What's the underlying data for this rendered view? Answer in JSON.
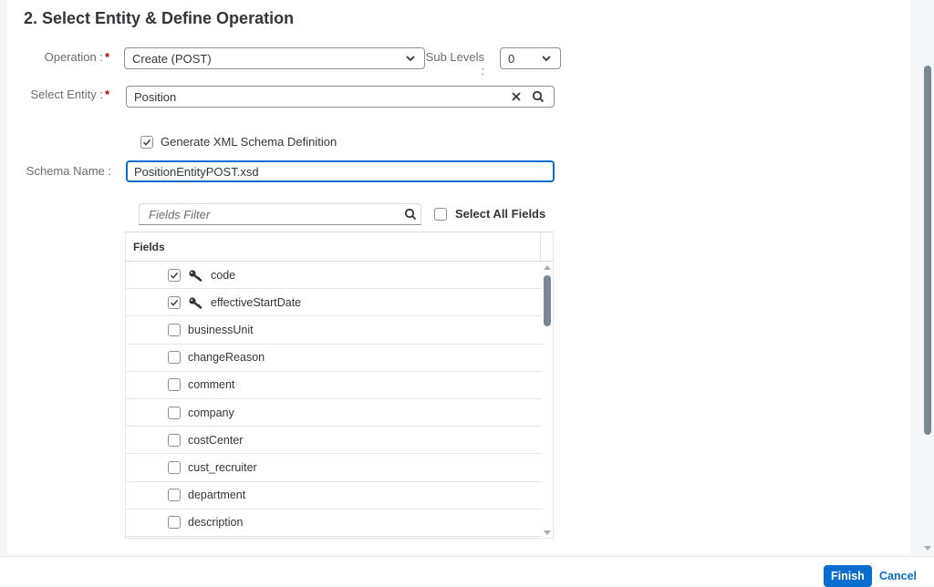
{
  "section_title": "2. Select Entity & Define Operation",
  "operation": {
    "label": "Operation :",
    "required_mark": "*",
    "value": "Create (POST)"
  },
  "sub_levels": {
    "label": "Sub Levels :",
    "value": "0"
  },
  "entity": {
    "label": "Select Entity :",
    "required_mark": "*",
    "value": "Position"
  },
  "generate_xsd": {
    "label": "Generate XML Schema Definition",
    "checked": true
  },
  "schema_name": {
    "label": "Schema Name :",
    "value": "PositionEntityPOST.xsd"
  },
  "fields_filter": {
    "placeholder": "Fields Filter"
  },
  "select_all": {
    "label": "Select All Fields",
    "checked": false
  },
  "fields_table": {
    "header": "Fields",
    "rows": [
      {
        "name": "code",
        "checked": true,
        "key": true
      },
      {
        "name": "effectiveStartDate",
        "checked": true,
        "key": true
      },
      {
        "name": "businessUnit",
        "checked": false,
        "key": false
      },
      {
        "name": "changeReason",
        "checked": false,
        "key": false
      },
      {
        "name": "comment",
        "checked": false,
        "key": false
      },
      {
        "name": "company",
        "checked": false,
        "key": false
      },
      {
        "name": "costCenter",
        "checked": false,
        "key": false
      },
      {
        "name": "cust_recruiter",
        "checked": false,
        "key": false
      },
      {
        "name": "department",
        "checked": false,
        "key": false
      },
      {
        "name": "description",
        "checked": false,
        "key": false
      }
    ]
  },
  "footer": {
    "finish": "Finish",
    "cancel": "Cancel"
  },
  "colors": {
    "accent": "#0a6ed1",
    "required": "#bb0000"
  }
}
